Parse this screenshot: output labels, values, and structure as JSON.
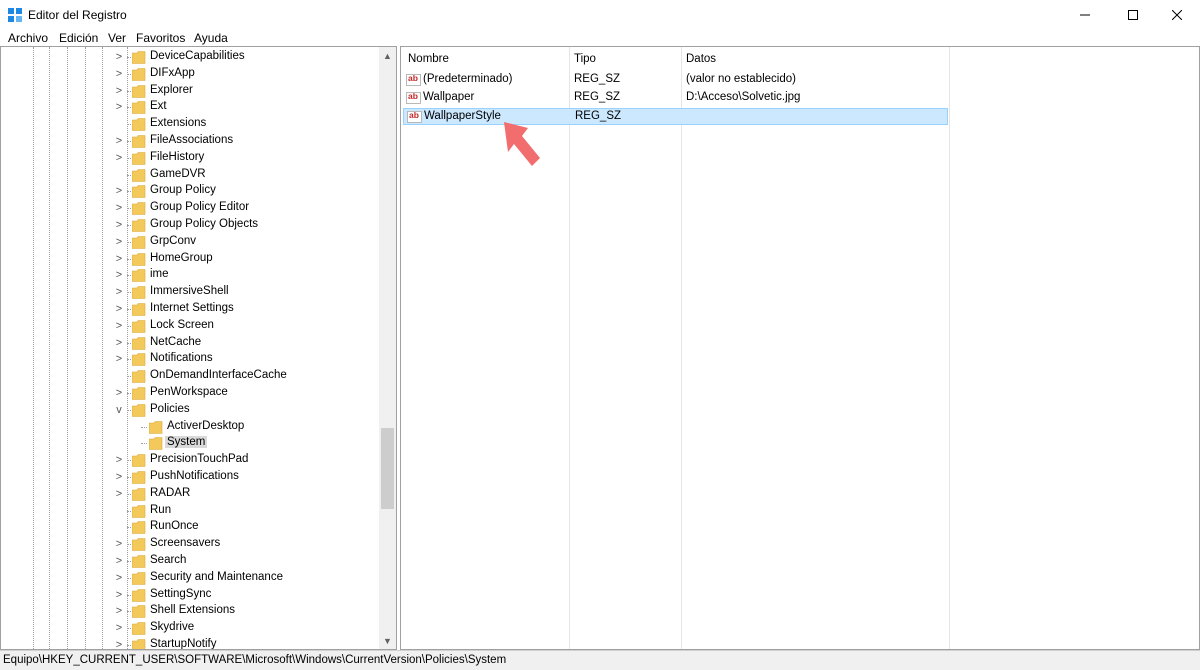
{
  "window": {
    "title": "Editor del Registro"
  },
  "menu": [
    "Archivo",
    "Edición",
    "Ver",
    "Favoritos",
    "Ayuda"
  ],
  "tree": {
    "items": [
      {
        "label": "DeviceCapabilities",
        "expander": ">"
      },
      {
        "label": "DIFxApp",
        "expander": ">"
      },
      {
        "label": "Explorer",
        "expander": ">"
      },
      {
        "label": "Ext",
        "expander": ">"
      },
      {
        "label": "Extensions",
        "expander": ""
      },
      {
        "label": "FileAssociations",
        "expander": ">"
      },
      {
        "label": "FileHistory",
        "expander": ">"
      },
      {
        "label": "GameDVR",
        "expander": ""
      },
      {
        "label": "Group Policy",
        "expander": ">"
      },
      {
        "label": "Group Policy Editor",
        "expander": ">"
      },
      {
        "label": "Group Policy Objects",
        "expander": ">"
      },
      {
        "label": "GrpConv",
        "expander": ">"
      },
      {
        "label": "HomeGroup",
        "expander": ">"
      },
      {
        "label": "ime",
        "expander": ">"
      },
      {
        "label": "ImmersiveShell",
        "expander": ">"
      },
      {
        "label": "Internet Settings",
        "expander": ">"
      },
      {
        "label": "Lock Screen",
        "expander": ">"
      },
      {
        "label": "NetCache",
        "expander": ">"
      },
      {
        "label": "Notifications",
        "expander": ">"
      },
      {
        "label": "OnDemandInterfaceCache",
        "expander": ""
      },
      {
        "label": "PenWorkspace",
        "expander": ">"
      },
      {
        "label": "Policies",
        "expander": "v"
      },
      {
        "label": "ActiverDesktop",
        "expander": "",
        "child": true
      },
      {
        "label": "System",
        "expander": "",
        "child": true,
        "selected": true
      },
      {
        "label": "PrecisionTouchPad",
        "expander": ">"
      },
      {
        "label": "PushNotifications",
        "expander": ">"
      },
      {
        "label": "RADAR",
        "expander": ">"
      },
      {
        "label": "Run",
        "expander": ""
      },
      {
        "label": "RunOnce",
        "expander": ""
      },
      {
        "label": "Screensavers",
        "expander": ">"
      },
      {
        "label": "Search",
        "expander": ">"
      },
      {
        "label": "Security and Maintenance",
        "expander": ">"
      },
      {
        "label": "SettingSync",
        "expander": ">"
      },
      {
        "label": "Shell Extensions",
        "expander": ">"
      },
      {
        "label": "Skydrive",
        "expander": ">"
      },
      {
        "label": "StartupNotify",
        "expander": ">"
      }
    ]
  },
  "list": {
    "columns": [
      "Nombre",
      "Tipo",
      "Datos"
    ],
    "rows": [
      {
        "name": "(Predeterminado)",
        "type": "REG_SZ",
        "data": "(valor no establecido)",
        "selected": false
      },
      {
        "name": "Wallpaper",
        "type": "REG_SZ",
        "data": "D:\\Acceso\\Solvetic.jpg",
        "selected": false
      },
      {
        "name": "WallpaperStyle",
        "type": "REG_SZ",
        "data": "",
        "selected": true
      }
    ],
    "value_icon_text": "ab"
  },
  "statusbar": {
    "path": "Equipo\\HKEY_CURRENT_USER\\SOFTWARE\\Microsoft\\Windows\\CurrentVersion\\Policies\\System"
  },
  "colors": {
    "folder": "#f2c95a",
    "selection": "#cce8ff",
    "annotation_arrow": "#f26d6d"
  },
  "icons": {
    "app": "registry-editor-icon",
    "minimize": "minimize-icon",
    "maximize": "maximize-icon",
    "close": "close-icon"
  }
}
